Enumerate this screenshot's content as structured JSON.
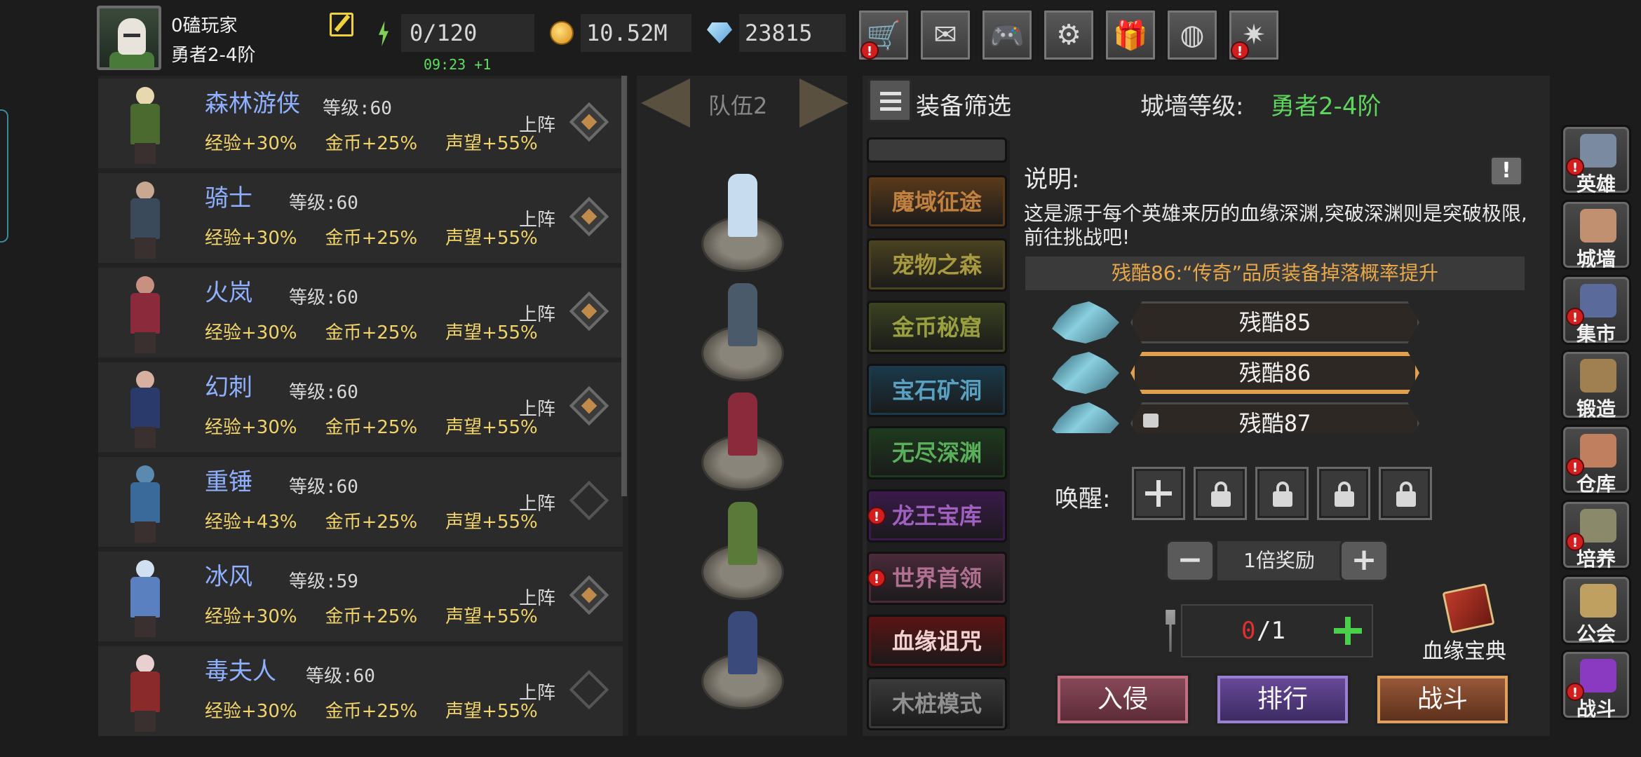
{
  "player": {
    "name": "0磕玩家",
    "rank": "勇者2-4阶"
  },
  "stats": {
    "energy": "0/120",
    "timer": "09:23 +1",
    "gold": "10.52M",
    "gems": "23815"
  },
  "top_buttons": [
    {
      "icon": "shop-cart-icon",
      "glyph": "🛒",
      "badge": "!"
    },
    {
      "icon": "mail-icon",
      "glyph": "✉",
      "badge": ""
    },
    {
      "icon": "gamepad-icon",
      "glyph": "🎮",
      "badge": ""
    },
    {
      "icon": "settings-gear-icon",
      "glyph": "⚙",
      "badge": ""
    },
    {
      "icon": "gift-icon",
      "glyph": "🎁",
      "badge": ""
    },
    {
      "icon": "lottery-wheel-icon",
      "glyph": "◍",
      "badge": ""
    },
    {
      "icon": "fireworks-icon",
      "glyph": "✷",
      "badge": "!"
    }
  ],
  "heroes": [
    {
      "name": "森林游侠",
      "level": "等级:60",
      "exp": "经验+30%",
      "gold": "金币+25%",
      "fame": "声望+55%",
      "action": "上阵",
      "deployed": true
    },
    {
      "name": "骑士",
      "level": "等级:60",
      "exp": "经验+30%",
      "gold": "金币+25%",
      "fame": "声望+55%",
      "action": "上阵",
      "deployed": true
    },
    {
      "name": "火岚",
      "level": "等级:60",
      "exp": "经验+30%",
      "gold": "金币+25%",
      "fame": "声望+55%",
      "action": "上阵",
      "deployed": true
    },
    {
      "name": "幻刺",
      "level": "等级:60",
      "exp": "经验+30%",
      "gold": "金币+25%",
      "fame": "声望+55%",
      "action": "上阵",
      "deployed": true
    },
    {
      "name": "重锤",
      "level": "等级:60",
      "exp": "经验+43%",
      "gold": "金币+25%",
      "fame": "声望+55%",
      "action": "上阵",
      "deployed": false
    },
    {
      "name": "冰风",
      "level": "等级:59",
      "exp": "经验+30%",
      "gold": "金币+25%",
      "fame": "声望+55%",
      "action": "上阵",
      "deployed": true
    },
    {
      "name": "毒夫人",
      "level": "等级:60",
      "exp": "经验+30%",
      "gold": "金币+25%",
      "fame": "声望+55%",
      "action": "上阵",
      "deployed": false
    }
  ],
  "team": {
    "title": "队伍2"
  },
  "filter": {
    "label": "装备筛选"
  },
  "wall": {
    "label": "城墙等级:",
    "value": "勇者2-4阶"
  },
  "modes": [
    {
      "label": "魔域征途",
      "badge": ""
    },
    {
      "label": "宠物之森",
      "badge": ""
    },
    {
      "label": "金币秘窟",
      "badge": ""
    },
    {
      "label": "宝石矿洞",
      "badge": ""
    },
    {
      "label": "无尽深渊",
      "badge": ""
    },
    {
      "label": "龙王宝库",
      "badge": "!"
    },
    {
      "label": "世界首领",
      "badge": "!"
    },
    {
      "label": "血缘诅咒",
      "badge": ""
    },
    {
      "label": "木桩模式",
      "badge": ""
    }
  ],
  "description": {
    "heading": "说明:",
    "info_glyph": "!",
    "text": "这是源于每个英雄来历的血缘深渊,突破深渊则是突破极限,前往挑战吧!",
    "highlight": "残酷86:“传奇”品质装备掉落概率提升"
  },
  "difficulties": [
    {
      "label": "残酷85",
      "selected": false,
      "locked": false
    },
    {
      "label": "残酷86",
      "selected": true,
      "locked": false
    },
    {
      "label": "残酷87",
      "selected": false,
      "locked": true
    }
  ],
  "awaken": {
    "label": "唤醒:",
    "slots": [
      "plus",
      "lock",
      "lock",
      "lock",
      "lock"
    ]
  },
  "reward": {
    "minus": "−",
    "label": "1倍奖励",
    "plus": "+"
  },
  "ticket": {
    "current": "0",
    "max": "/1"
  },
  "codex": {
    "label": "血缘宝典"
  },
  "actions": {
    "invade": "入侵",
    "rank": "排行",
    "fight": "战斗"
  },
  "side_nav": [
    {
      "label": "英雄",
      "badge": "!"
    },
    {
      "label": "城墙",
      "badge": ""
    },
    {
      "label": "集市",
      "badge": "!"
    },
    {
      "label": "锻造",
      "badge": ""
    },
    {
      "label": "仓库",
      "badge": "!"
    },
    {
      "label": "培养",
      "badge": "!"
    },
    {
      "label": "公会",
      "badge": ""
    },
    {
      "label": "战斗",
      "badge": "!"
    }
  ]
}
